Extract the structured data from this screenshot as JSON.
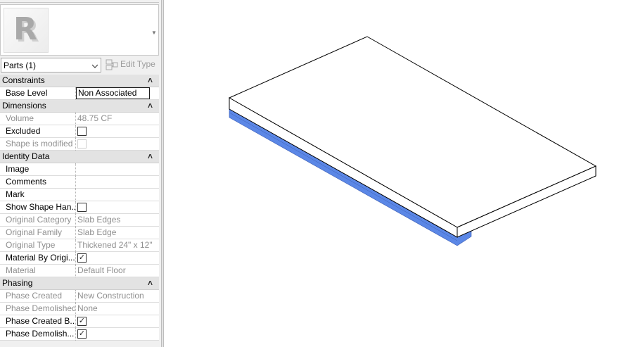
{
  "properties": {
    "type_thumb_letter": "R",
    "filter": "Parts (1)",
    "edit_type": "Edit Type",
    "groups": [
      {
        "label": "Constraints",
        "collapse_glyph": "˄",
        "rows": [
          {
            "name": "Base Level",
            "value": "Non Associated"
          }
        ]
      },
      {
        "label": "Dimensions",
        "collapse_glyph": "˄",
        "rows": [
          {
            "name": "Volume",
            "value": "48.75 CF"
          },
          {
            "name": "Excluded",
            "checked": false
          },
          {
            "name": "Shape is modified",
            "checked": false
          }
        ]
      },
      {
        "label": "Identity Data",
        "collapse_glyph": "˄",
        "rows": [
          {
            "name": "Image",
            "value": ""
          },
          {
            "name": "Comments",
            "value": ""
          },
          {
            "name": "Mark",
            "value": ""
          },
          {
            "name": "Show Shape Han...",
            "checked": false
          },
          {
            "name": "Original Category",
            "value": "Slab Edges"
          },
          {
            "name": "Original Family",
            "value": "Slab Edge"
          },
          {
            "name": "Original Type",
            "value": "Thickened 24\" x 12\""
          },
          {
            "name": "Material By Origi...",
            "checked": true
          },
          {
            "name": "Material",
            "value": "Default Floor"
          }
        ]
      },
      {
        "label": "Phasing",
        "collapse_glyph": "˄",
        "rows": [
          {
            "name": "Phase Created",
            "value": "New Construction"
          },
          {
            "name": "Phase Demolished",
            "value": "None"
          },
          {
            "name": "Phase Created B...",
            "checked": true
          },
          {
            "name": "Phase Demolish...",
            "checked": true
          }
        ]
      }
    ]
  },
  "viewport": {
    "selection_color": "#5b87e6",
    "edge_color": "#000000"
  }
}
